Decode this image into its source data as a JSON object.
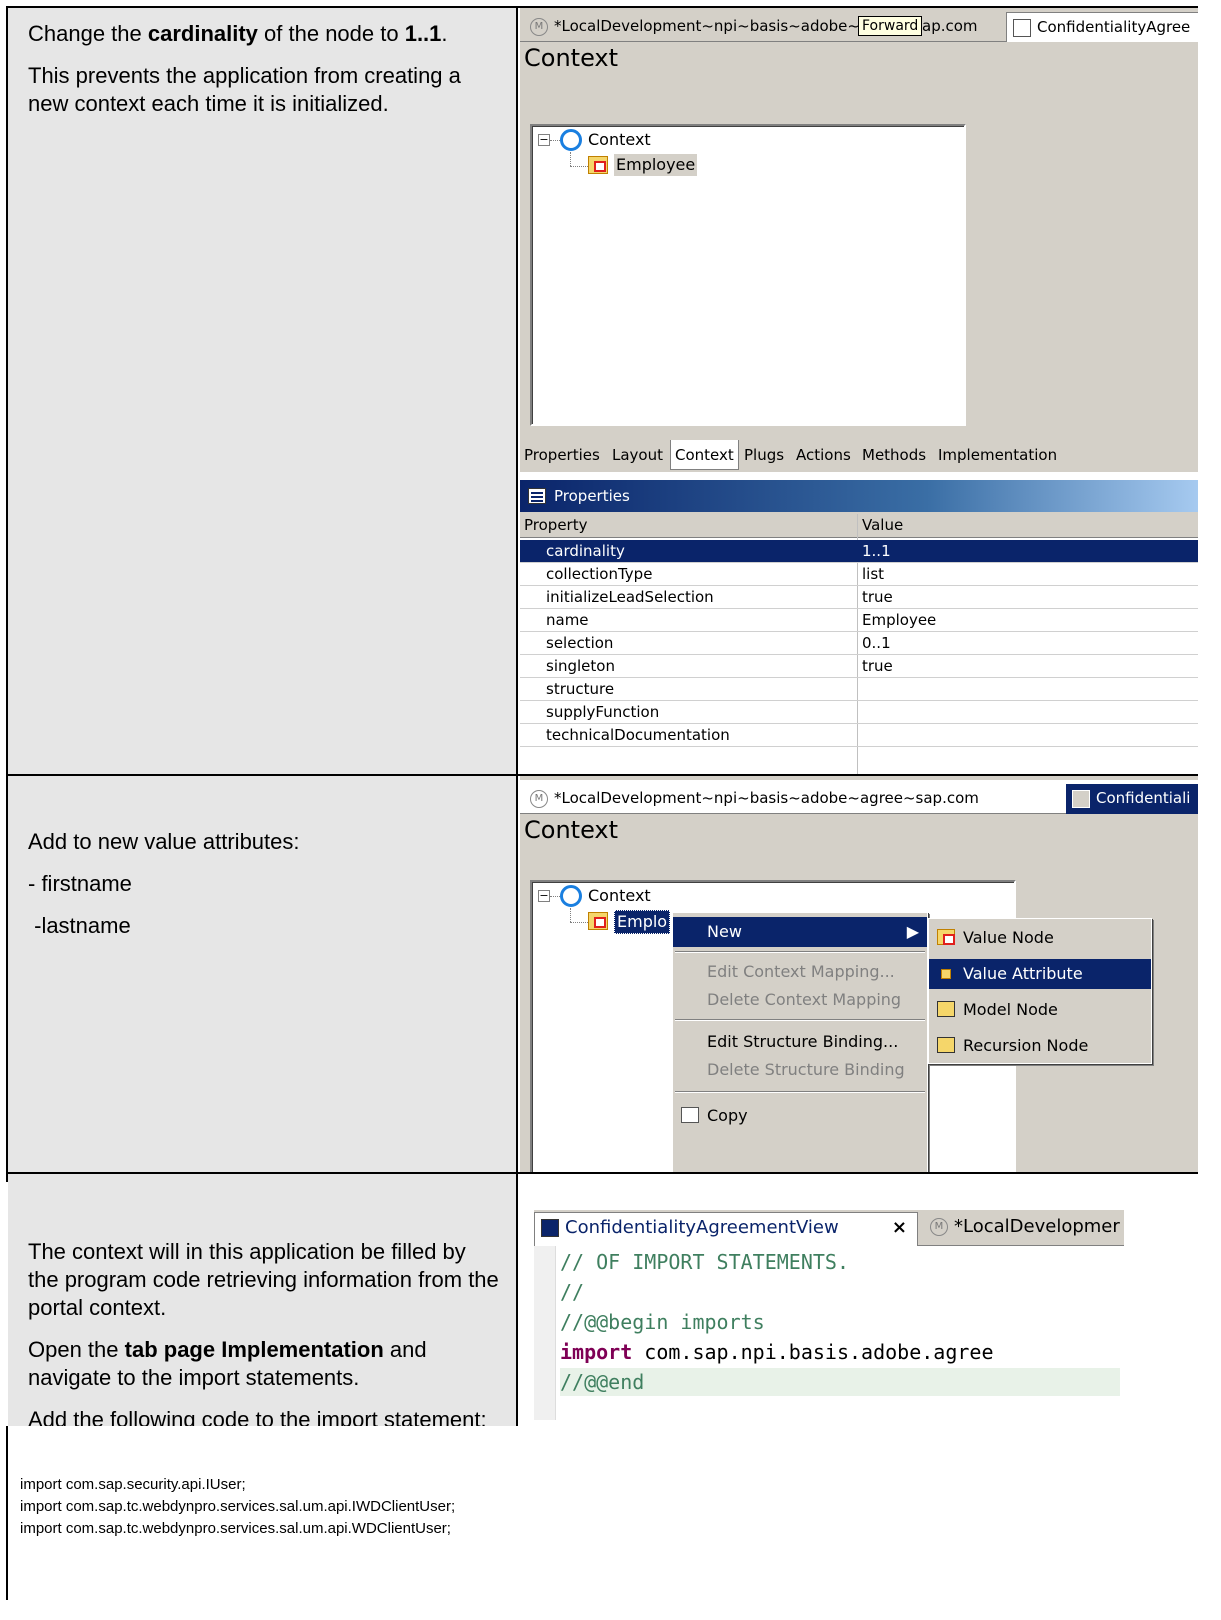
{
  "row1": {
    "instructions": {
      "p1_pre": "Change the ",
      "p1_bold": "cardinality",
      "p1_mid": " of the node to ",
      "p1_bold2": "1..1",
      "p1_end": ".",
      "p2": "This prevents the application from creating a new context each time it is initialized."
    },
    "ide": {
      "tab1": "*LocalDevelopment~npi~basis~adobe~",
      "tooltip": "Forward",
      "tab1_tail": "ap.com",
      "tab2": "ConfidentialityAgree",
      "title": "Context",
      "tree": [
        "Context",
        "Employee"
      ],
      "bottom_tabs": [
        "Properties",
        "Layout",
        "Context",
        "Plugs",
        "Actions",
        "Methods",
        "Implementation"
      ],
      "properties_title": "Properties",
      "columns": [
        "Property",
        "Value"
      ],
      "rows": [
        {
          "k": "cardinality",
          "v": "1..1"
        },
        {
          "k": "collectionType",
          "v": "list"
        },
        {
          "k": "initializeLeadSelection",
          "v": "true"
        },
        {
          "k": "name",
          "v": "Employee"
        },
        {
          "k": "selection",
          "v": "0..1"
        },
        {
          "k": "singleton",
          "v": "true"
        },
        {
          "k": "structure",
          "v": ""
        },
        {
          "k": "supplyFunction",
          "v": ""
        },
        {
          "k": "technicalDocumentation",
          "v": ""
        }
      ]
    }
  },
  "row2": {
    "instructions": {
      "p1": "Add to new value attributes:",
      "p2": "- firstname",
      "p3": " -lastname"
    },
    "ide": {
      "tab1": "*LocalDevelopment~npi~basis~adobe~agree~sap.com",
      "tab2": "Confidentiali",
      "title": "Context",
      "tree": [
        "Context",
        "Emplo"
      ],
      "menu": [
        "New",
        "Edit Context Mapping...",
        "Delete Context Mapping",
        "Edit Structure Binding...",
        "Delete Structure Binding",
        "Copy"
      ],
      "submenu": [
        "Value Node",
        "Value Attribute",
        "Model Node",
        "Recursion Node"
      ]
    }
  },
  "row3": {
    "instructions": {
      "p1": "The context will in this application be filled by the program code retrieving information from the portal context.",
      "p2_pre": "Open the ",
      "p2_bold": "tab page Implementation",
      "p2_end": " and navigate to the import statements.",
      "p3": "Add the following code to the import statement:"
    },
    "ide": {
      "tab1": "ConfidentialityAgreementView",
      "close": "×",
      "tab2": "*LocalDevelopmer",
      "lines": [
        {
          "type": "comment",
          "text": "// OF IMPORT STATEMENTS."
        },
        {
          "type": "comment",
          "text": "//"
        },
        {
          "type": "comment",
          "text": "//@@begin imports"
        },
        {
          "type": "import",
          "kw": "import",
          "text": " com.sap.npi.basis.adobe.agree"
        },
        {
          "type": "comment",
          "text": "//@@end"
        }
      ]
    }
  },
  "code": [
    "import com.sap.security.api.IUser;",
    "import com.sap.tc.webdynpro.services.sal.um.api.IWDClientUser;",
    "import com.sap.tc.webdynpro.services.sal.um.api.WDClientUser;"
  ]
}
